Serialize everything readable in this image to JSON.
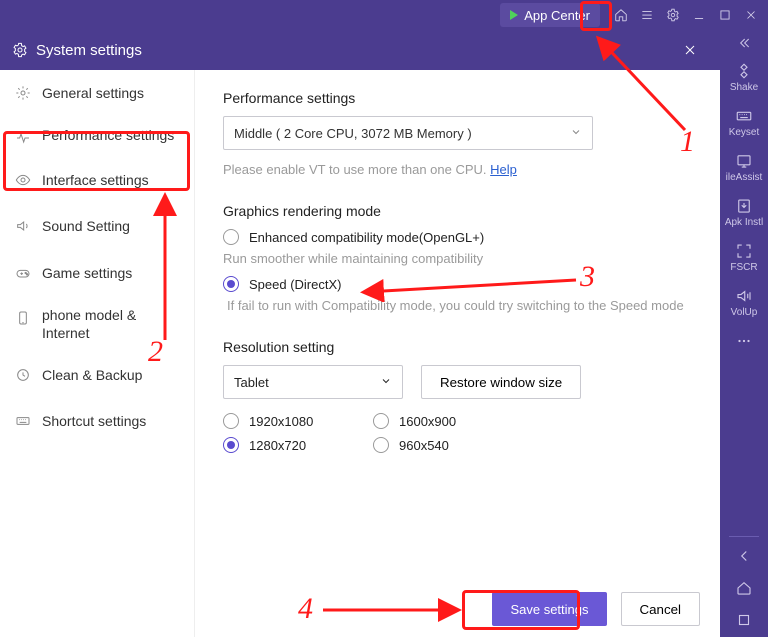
{
  "titlebar": {
    "app_center_label": "App Center"
  },
  "right_rail": {
    "items": [
      {
        "name": "shake",
        "label": "Shake"
      },
      {
        "name": "keyset",
        "label": "Keyset"
      },
      {
        "name": "fileassist",
        "label": "ileAssist"
      },
      {
        "name": "apkinstl",
        "label": "Apk Instl"
      },
      {
        "name": "fscr",
        "label": "FSCR"
      },
      {
        "name": "volup",
        "label": "VolUp"
      }
    ]
  },
  "sys_header": {
    "title": "System settings"
  },
  "sidebar": {
    "items": [
      {
        "name": "general",
        "label": "General settings"
      },
      {
        "name": "performance",
        "label": "Performance settings"
      },
      {
        "name": "interface",
        "label": "Interface settings"
      },
      {
        "name": "sound",
        "label": "Sound Setting"
      },
      {
        "name": "game",
        "label": "Game settings"
      },
      {
        "name": "phone",
        "label": "phone model & Internet"
      },
      {
        "name": "clean",
        "label": "Clean & Backup"
      },
      {
        "name": "shortcut",
        "label": "Shortcut settings"
      }
    ]
  },
  "main": {
    "perf_title": "Performance settings",
    "perf_select": "Middle ( 2 Core CPU, 3072 MB Memory )",
    "vt_hint": "Please enable VT to use more than one CPU. ",
    "vt_help": "Help",
    "gfx_title": "Graphics rendering mode",
    "gfx_opt_compat": "Enhanced compatibility mode(OpenGL+)",
    "gfx_desc_compat": "Run smoother while maintaining compatibility",
    "gfx_opt_speed": "Speed (DirectX)",
    "gfx_desc_speed": "If fail to run with Compatibility mode, you could try switching to the Speed mode",
    "res_title": "Resolution setting",
    "res_select": "Tablet",
    "res_restore": "Restore window size",
    "res_options": [
      "1920x1080",
      "1600x900",
      "1280x720",
      "960x540"
    ],
    "res_selected": "1280x720"
  },
  "footer": {
    "save": "Save settings",
    "cancel": "Cancel"
  },
  "annotations": {
    "n1": "1",
    "n2": "2",
    "n3": "3",
    "n4": "4"
  }
}
